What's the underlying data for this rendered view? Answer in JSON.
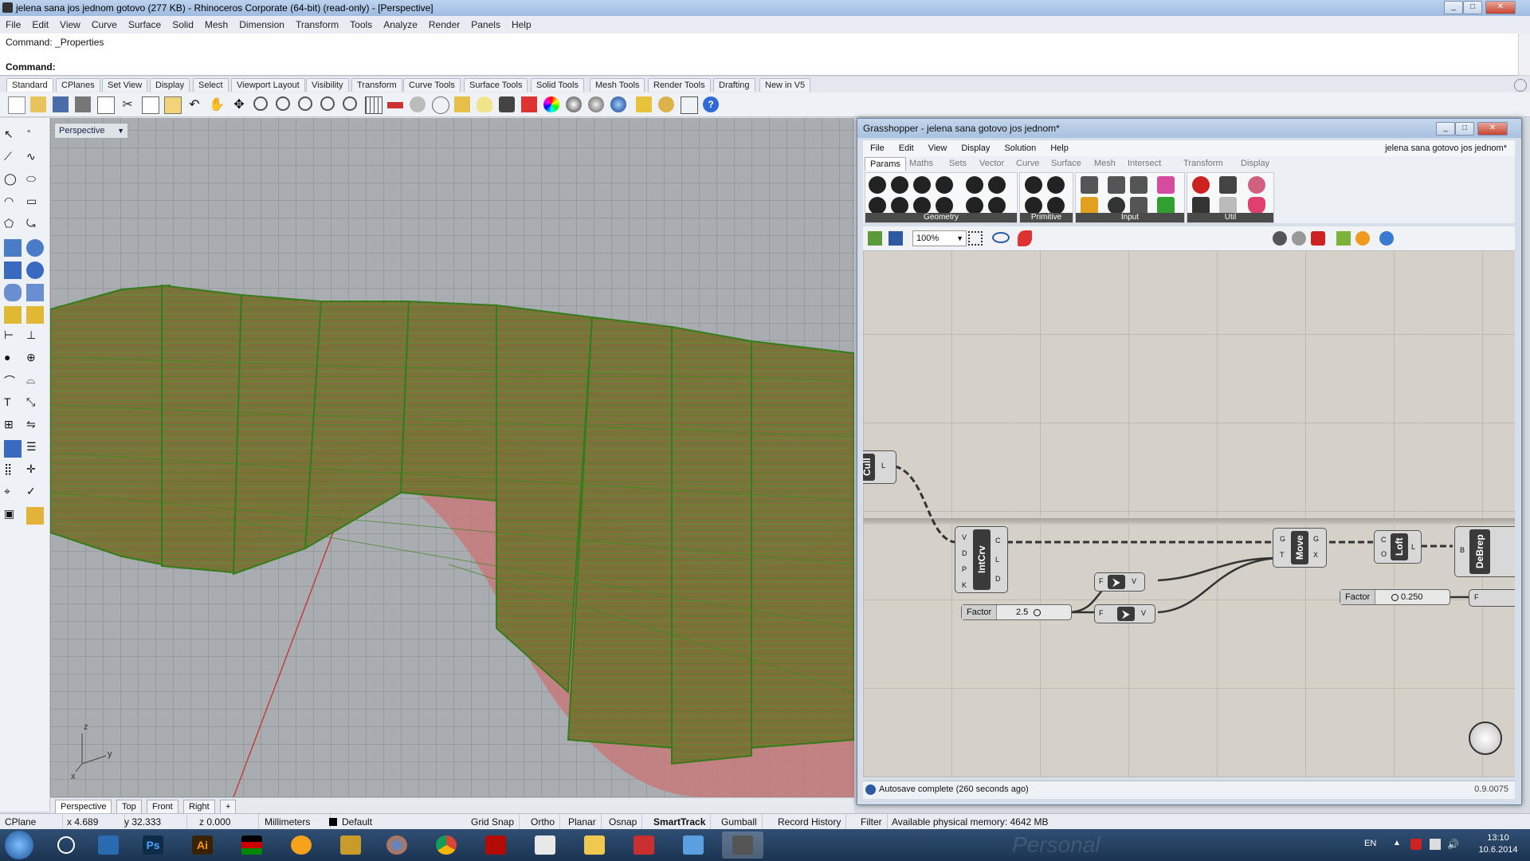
{
  "window": {
    "title": "jelena sana jos jednom gotovo (277 KB) - Rhinoceros Corporate (64-bit) (read-only) - [Perspective]"
  },
  "menu": [
    "File",
    "Edit",
    "View",
    "Curve",
    "Surface",
    "Solid",
    "Mesh",
    "Dimension",
    "Transform",
    "Tools",
    "Analyze",
    "Render",
    "Panels",
    "Help"
  ],
  "command": {
    "history": "Command: _Properties",
    "prompt": "Command:"
  },
  "toolbar_tabs": [
    "Standard",
    "CPlanes",
    "Set View",
    "Display",
    "Select",
    "Viewport Layout",
    "Visibility",
    "Transform",
    "Curve Tools",
    "Surface Tools",
    "Solid Tools",
    "Mesh Tools",
    "Render Tools",
    "Drafting",
    "New in V5"
  ],
  "viewport": {
    "label": "Perspective",
    "axes": {
      "z": "z",
      "y": "y",
      "x": "x"
    },
    "tabs": [
      "Perspective",
      "Top",
      "Front",
      "Right"
    ],
    "add_tab": "+"
  },
  "status": {
    "cplane": "CPlane",
    "x": "x 4.689",
    "y": "y 32.333",
    "z": "z 0.000",
    "units": "Millimeters",
    "layer": "Default",
    "grid_snap": "Grid Snap",
    "ortho": "Ortho",
    "planar": "Planar",
    "osnap": "Osnap",
    "smarttrack": "SmartTrack",
    "gumball": "Gumball",
    "record_history": "Record History",
    "filter": "Filter",
    "memory": "Available physical memory: 4642 MB"
  },
  "grasshopper": {
    "title": "Grasshopper - jelena sana gotovo jos jednom*",
    "menu": [
      "File",
      "Edit",
      "View",
      "Display",
      "Solution",
      "Help"
    ],
    "doc_name": "jelena sana gotovo jos jednom*",
    "tabs": [
      "Params",
      "Maths",
      "Sets",
      "Vector",
      "Curve",
      "Surface",
      "Mesh",
      "Intersect",
      "Transform",
      "Display"
    ],
    "ribbon_groups": [
      "Geometry",
      "Primitive",
      "Input",
      "Util"
    ],
    "zoom": "100%",
    "components": {
      "cull": {
        "label": "Cull",
        "out": "L"
      },
      "intcrv": {
        "label": "IntCrv",
        "inputs": [
          "V",
          "D",
          "P",
          "K"
        ],
        "outputs": [
          "C",
          "L",
          "D"
        ]
      },
      "move": {
        "label": "Move",
        "inputs": [
          "G",
          "T"
        ],
        "outputs": [
          "G",
          "X"
        ]
      },
      "loft": {
        "label": "Loft",
        "inputs": [
          "C",
          "O"
        ],
        "outputs": [
          "L"
        ]
      },
      "debrep": {
        "label": "DeBrep",
        "inputs": [
          "B"
        ]
      },
      "vec1": {
        "in": "F",
        "out": "V"
      },
      "vec2": {
        "in": "F",
        "out": "V"
      },
      "factor1": {
        "name": "Factor",
        "value": "2.5"
      },
      "factor2": {
        "name": "Factor",
        "value": "0.250"
      },
      "partial": "F"
    },
    "status": "Autosave complete (260 seconds ago)",
    "version": "0.9.0075"
  },
  "taskbar": {
    "apps": [
      "start",
      "search",
      "gsn",
      "Ps",
      "Ai",
      "kenya-flag",
      "weather",
      "gsplit",
      "firefox",
      "chrome",
      "acrobat",
      "notepad",
      "explorer",
      "xmind",
      "paint",
      "rhino"
    ],
    "lang": "EN",
    "time": "13:10",
    "date": "10.6.2014",
    "watermark": "Personal"
  },
  "colors": {
    "surface_green": "#3d8a1f",
    "surface_fill": "#7a6a32",
    "ground_red": "#c87878",
    "viewport_bg": "#a9acb0",
    "gh_canvas": "#d5d1c8"
  }
}
